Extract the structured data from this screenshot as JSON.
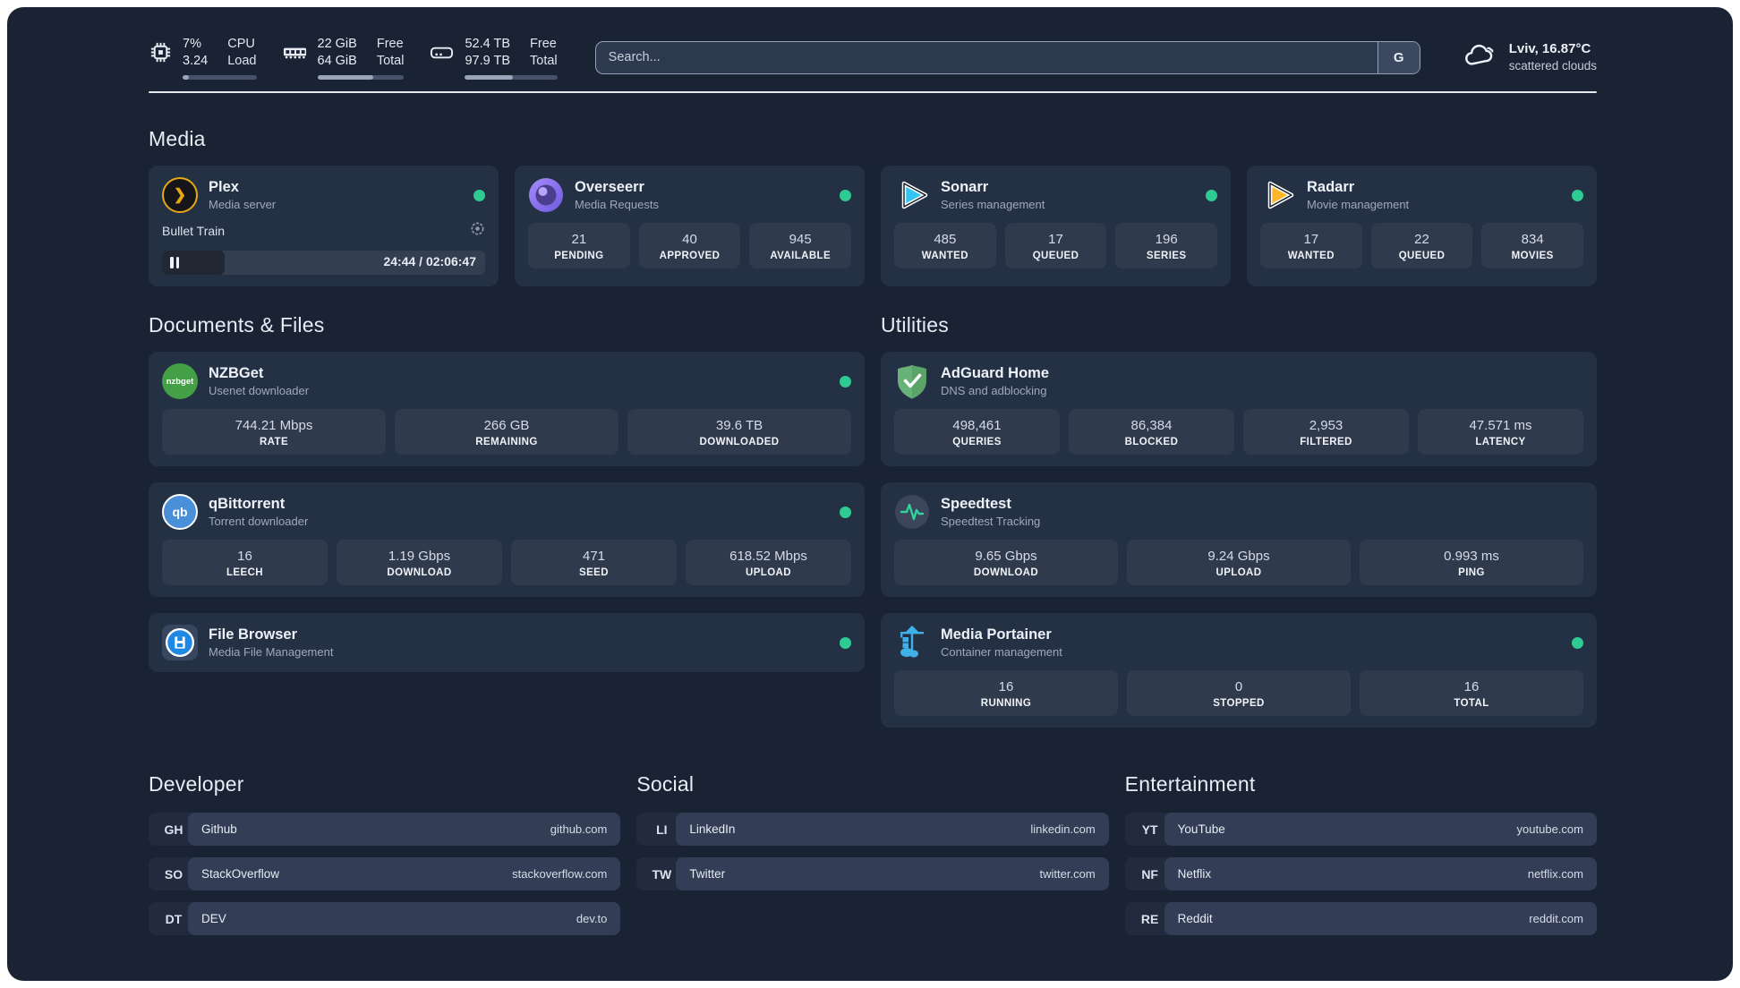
{
  "header": {
    "cpu": {
      "v1": "7%",
      "v2": "3.24",
      "l1": "CPU",
      "l2": "Load",
      "progress": 8
    },
    "memory": {
      "v1": "22 GiB",
      "v2": "64 GiB",
      "l1": "Free",
      "l2": "Total",
      "progress": 64
    },
    "disk": {
      "v1": "52.4 TB",
      "v2": "97.9 TB",
      "l1": "Free",
      "l2": "Total",
      "progress": 52
    },
    "search": {
      "placeholder": "Search...",
      "engine_label": "G"
    },
    "weather": {
      "location": "Lviv, 16.87°C",
      "condition": "scattered clouds"
    }
  },
  "media": {
    "title": "Media",
    "plex": {
      "name": "Plex",
      "desc": "Media server",
      "status": "online",
      "player": {
        "title": "Bullet Train",
        "time": "24:44 / 02:06:47",
        "progress": 19.5
      }
    },
    "overseerr": {
      "name": "Overseerr",
      "desc": "Media Requests",
      "status": "online",
      "stats": [
        {
          "value": "21",
          "label": "PENDING"
        },
        {
          "value": "40",
          "label": "APPROVED"
        },
        {
          "value": "945",
          "label": "AVAILABLE"
        }
      ]
    },
    "sonarr": {
      "name": "Sonarr",
      "desc": "Series management",
      "status": "online",
      "stats": [
        {
          "value": "485",
          "label": "WANTED"
        },
        {
          "value": "17",
          "label": "QUEUED"
        },
        {
          "value": "196",
          "label": "SERIES"
        }
      ]
    },
    "radarr": {
      "name": "Radarr",
      "desc": "Movie management",
      "status": "online",
      "stats": [
        {
          "value": "17",
          "label": "WANTED"
        },
        {
          "value": "22",
          "label": "QUEUED"
        },
        {
          "value": "834",
          "label": "MOVIES"
        }
      ]
    }
  },
  "documents": {
    "title": "Documents & Files",
    "nzbget": {
      "name": "NZBGet",
      "desc": "Usenet downloader",
      "status": "online",
      "icon_label": "nzbget",
      "stats": [
        {
          "value": "744.21 Mbps",
          "label": "RATE"
        },
        {
          "value": "266 GB",
          "label": "REMAINING"
        },
        {
          "value": "39.6 TB",
          "label": "DOWNLOADED"
        }
      ]
    },
    "qbittorrent": {
      "name": "qBittorrent",
      "desc": "Torrent downloader",
      "status": "online",
      "icon_label": "qb",
      "stats": [
        {
          "value": "16",
          "label": "LEECH"
        },
        {
          "value": "1.19 Gbps",
          "label": "DOWNLOAD"
        },
        {
          "value": "471",
          "label": "SEED"
        },
        {
          "value": "618.52 Mbps",
          "label": "UPLOAD"
        }
      ]
    },
    "filebrowser": {
      "name": "File Browser",
      "desc": "Media File Management",
      "status": "online"
    }
  },
  "utilities": {
    "title": "Utilities",
    "adguard": {
      "name": "AdGuard Home",
      "desc": "DNS and adblocking",
      "stats": [
        {
          "value": "498,461",
          "label": "QUERIES"
        },
        {
          "value": "86,384",
          "label": "BLOCKED"
        },
        {
          "value": "2,953",
          "label": "FILTERED"
        },
        {
          "value": "47.571 ms",
          "label": "LATENCY"
        }
      ]
    },
    "speedtest": {
      "name": "Speedtest",
      "desc": "Speedtest Tracking",
      "stats": [
        {
          "value": "9.65 Gbps",
          "label": "DOWNLOAD"
        },
        {
          "value": "9.24 Gbps",
          "label": "UPLOAD"
        },
        {
          "value": "0.993 ms",
          "label": "PING"
        }
      ]
    },
    "portainer": {
      "name": "Media Portainer",
      "desc": "Container management",
      "status": "online",
      "stats": [
        {
          "value": "16",
          "label": "RUNNING"
        },
        {
          "value": "0",
          "label": "STOPPED"
        },
        {
          "value": "16",
          "label": "TOTAL"
        }
      ]
    }
  },
  "bookmarks": {
    "developer": {
      "title": "Developer",
      "links": [
        {
          "abbr": "GH",
          "name": "Github",
          "url": "github.com"
        },
        {
          "abbr": "SO",
          "name": "StackOverflow",
          "url": "stackoverflow.com"
        },
        {
          "abbr": "DT",
          "name": "DEV",
          "url": "dev.to"
        }
      ]
    },
    "social": {
      "title": "Social",
      "links": [
        {
          "abbr": "LI",
          "name": "LinkedIn",
          "url": "linkedin.com"
        },
        {
          "abbr": "TW",
          "name": "Twitter",
          "url": "twitter.com"
        }
      ]
    },
    "entertainment": {
      "title": "Entertainment",
      "links": [
        {
          "abbr": "YT",
          "name": "YouTube",
          "url": "youtube.com"
        },
        {
          "abbr": "NF",
          "name": "Netflix",
          "url": "netflix.com"
        },
        {
          "abbr": "RE",
          "name": "Reddit",
          "url": "reddit.com"
        }
      ]
    }
  },
  "colors": {
    "status_online": "#2ecb93",
    "accent_gold": "#e7a813",
    "accent_blue": "#35c5f4"
  }
}
